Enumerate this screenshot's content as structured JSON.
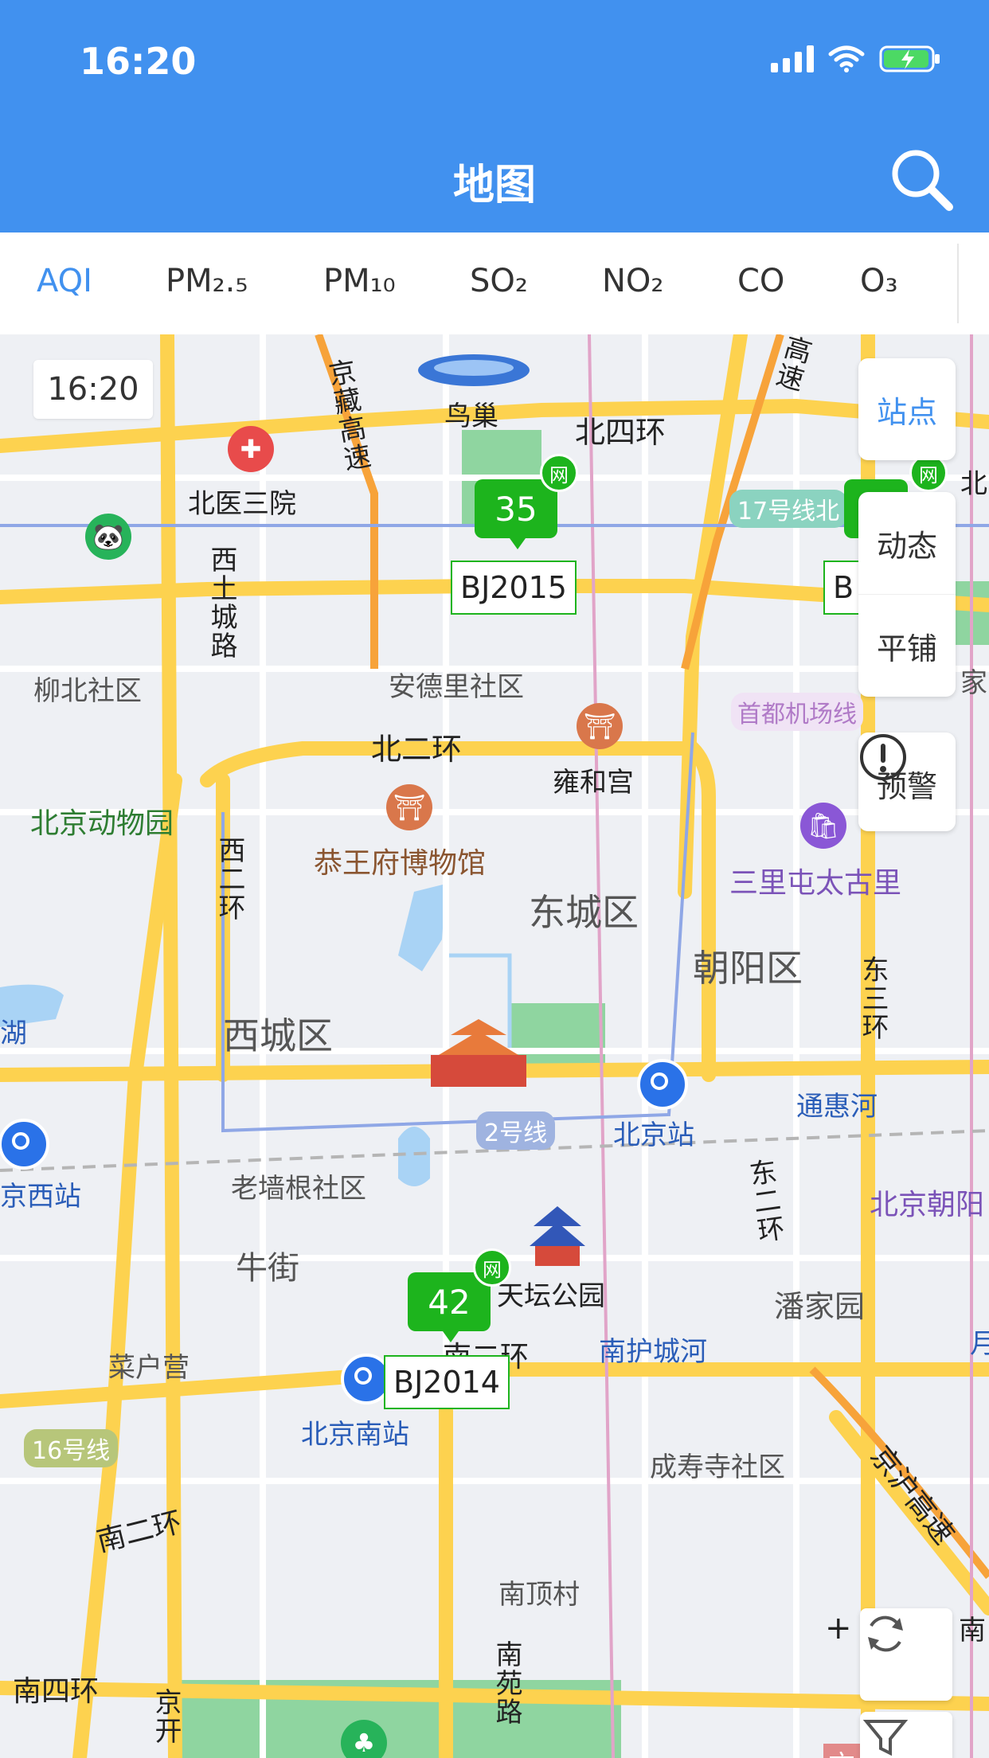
{
  "status_bar": {
    "time": "16:20"
  },
  "nav": {
    "title": "地图"
  },
  "tabs": [
    {
      "label": "AQI",
      "active": true
    },
    {
      "label": "PM₂.₅"
    },
    {
      "label": "PM₁₀"
    },
    {
      "label": "SO₂"
    },
    {
      "label": "NO₂"
    },
    {
      "label": "CO"
    },
    {
      "label": "O₃"
    }
  ],
  "map": {
    "time_label": "16:20",
    "stations": [
      {
        "aqi": "35",
        "id": "BJ2015",
        "badge": "网"
      },
      {
        "aqi": "42",
        "id": "BJ2014",
        "badge": "网"
      },
      {
        "id": "B",
        "badge": "网"
      }
    ],
    "labels": {
      "niaochao": "鸟巢",
      "beisihuan": "北四环",
      "beiyisanyuan": "北医三院",
      "jingzang": "京藏高速",
      "xisancheng": "西土城路",
      "liubei": "柳北社区",
      "andeli": "安德里社区",
      "beierhuan": "北二环",
      "yonghegong": "雍和宫",
      "shoudu": "首都机场线",
      "zoo": "北京动物园",
      "xierhuan": "西二环",
      "gongwangfu": "恭王府博物馆",
      "sanlitun": "三里屯太古里",
      "dongcheng": "东城区",
      "chaoyang": "朝阳区",
      "dongsanhuan": "东三环",
      "xicheng": "西城区",
      "tonghuihe": "通惠河",
      "line2": "2号线",
      "bjstation": "北京站",
      "bjwest": "京西站",
      "laoqianggen": "老墙根社区",
      "bjchaoyang": "北京朝阳",
      "dongerhuan": "东二环",
      "niujie": "牛街",
      "tiantan": "天坛公园",
      "panjiayuan": "潘家园",
      "caihuying": "菜户营",
      "nanerhuan1": "南二环",
      "nanhu": "南护城河",
      "bjsouth": "北京南站",
      "line16": "16号线",
      "chengshousi": "成寿寺社区",
      "jinghu": "京沪高速",
      "nanerhuan2": "南二环",
      "nandingcun": "南顶村",
      "nansihuan": "南四环",
      "nanyuan": "南苑路",
      "jingkai": "京开",
      "line17": "17号线北",
      "gaosu": "高速",
      "hu": "湖",
      "nan": "南",
      "beiedge": "北",
      "jiaedge": "家",
      "yue": "月",
      "yi": "亦"
    }
  },
  "controls": {
    "layers": [
      "站点",
      "动态",
      "平铺"
    ],
    "warning": "预警"
  }
}
